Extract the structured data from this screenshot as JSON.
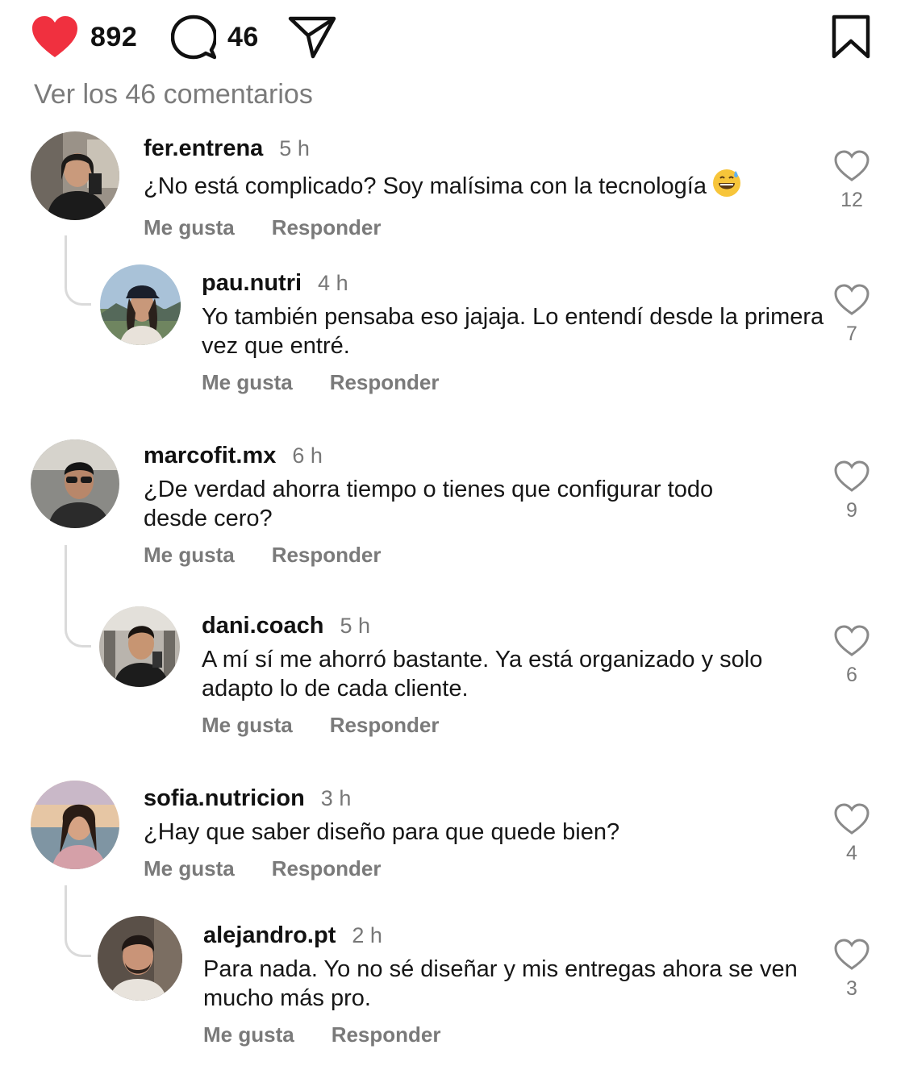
{
  "post": {
    "like_count": "892",
    "comment_count": "46",
    "view_all_comments": "Ver los 46 comentarios"
  },
  "colors": {
    "heart_red": "#f0303f",
    "text_primary": "#111111",
    "text_secondary": "#7a7a7a",
    "thread_line": "#dadada"
  },
  "labels": {
    "like": "Me gusta",
    "reply": "Responder"
  },
  "comments": [
    {
      "username": "fer.entrena",
      "time": "5 h",
      "text": "¿No está complicado? Soy malísima con la tecnología",
      "emoji": "grinning-sweat-emoji",
      "likes": "12",
      "replies": [
        {
          "username": "pau.nutri",
          "time": "4 h",
          "text_lines": [
            "Yo también pensaba eso jajaja. Lo entendí desde la primera",
            "vez que entré."
          ],
          "likes": "7"
        }
      ]
    },
    {
      "username": "marcofit.mx",
      "time": "6 h",
      "text_lines": [
        "¿De verdad ahorra tiempo o tienes que configurar todo",
        "desde cero?"
      ],
      "likes": "9",
      "replies": [
        {
          "username": "dani.coach",
          "time": "5 h",
          "text_lines": [
            "A mí sí me ahorró bastante. Ya está organizado y solo",
            "adapto lo de cada cliente."
          ],
          "likes": "6"
        }
      ]
    },
    {
      "username": "sofia.nutricion",
      "time": "3 h",
      "text": "¿Hay que saber diseño para que quede bien?",
      "likes": "4",
      "replies": [
        {
          "username": "alejandro.pt",
          "time": "2 h",
          "text_lines": [
            "Para nada. Yo no sé diseñar y mis entregas ahora se ven",
            "mucho más pro."
          ],
          "likes": "3"
        }
      ]
    }
  ]
}
